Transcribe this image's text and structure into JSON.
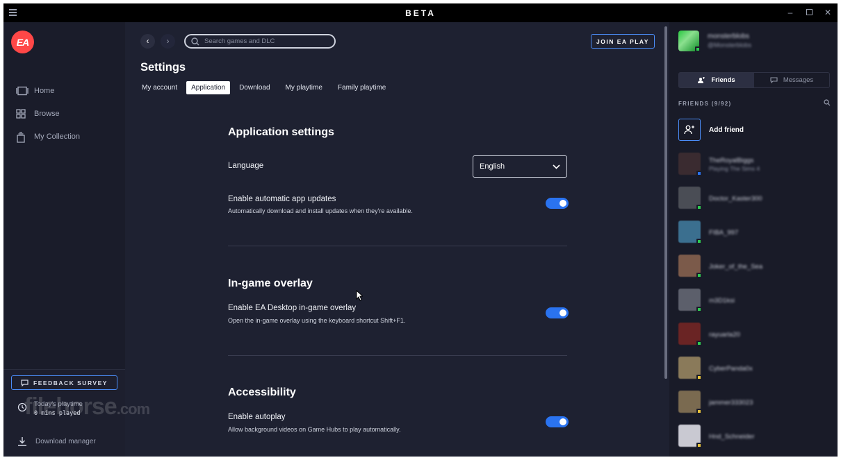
{
  "titlebar": {
    "title": "BETA"
  },
  "leftnav": {
    "items": [
      {
        "label": "Home",
        "icon": "home-icon"
      },
      {
        "label": "Browse",
        "icon": "grid-icon"
      },
      {
        "label": "My Collection",
        "icon": "collection-icon"
      }
    ],
    "feedback_label": "FEEDBACK SURVEY",
    "playtime_label": "Today's playtime",
    "playtime_value": "0 mins played",
    "download_manager": "Download manager"
  },
  "watermark": {
    "brand": "filehorse",
    "suffix": ".com"
  },
  "topbar": {
    "search_placeholder": "Search games and DLC",
    "join_label": "JOIN EA PLAY"
  },
  "settings": {
    "title": "Settings",
    "tabs": [
      "My account",
      "Application",
      "Download",
      "My playtime",
      "Family playtime"
    ],
    "active_tab": "Application",
    "sections": {
      "application": {
        "title": "Application settings",
        "language_label": "Language",
        "language_value": "English",
        "auto_update_label": "Enable automatic app updates",
        "auto_update_desc": "Automatically download and install updates when they're available.",
        "auto_update_on": true
      },
      "overlay": {
        "title": "In-game overlay",
        "label": "Enable EA Desktop in-game overlay",
        "desc": "Open the in-game overlay using the keyboard shortcut Shift+F1.",
        "on": true
      },
      "accessibility": {
        "title": "Accessibility",
        "label": "Enable autoplay",
        "desc": "Allow background videos on Game Hubs to play automatically.",
        "on": true
      }
    }
  },
  "social": {
    "me": {
      "name": "monsterblobs",
      "handle": "@Monsterblobs"
    },
    "tabs": {
      "friends": "Friends",
      "messages": "Messages"
    },
    "friends_header": "FRIENDS (9/92)",
    "add_friend": "Add friend",
    "friends": [
      {
        "name": "TheRoyalBiggs",
        "status": "Playing The Sims 4",
        "color": "#3a2b30",
        "dot": "#2a73f0"
      },
      {
        "name": "Doctor_Kaster300",
        "status": "",
        "color": "#4a4d55",
        "dot": "#2ecc51"
      },
      {
        "name": "FIBA_997",
        "status": "",
        "color": "#3b6f8f",
        "dot": "#2ecc51"
      },
      {
        "name": "Joker_of_the_Sea",
        "status": "",
        "color": "#7b5a4a",
        "dot": "#2ecc51"
      },
      {
        "name": "m3D1ksi",
        "status": "",
        "color": "#5c5f6b",
        "dot": "#2ecc51"
      },
      {
        "name": "rayuarla20",
        "status": "",
        "color": "#6a2424",
        "dot": "#2ecc51"
      },
      {
        "name": "CyberPanda0x",
        "status": "",
        "color": "#8a7a5a",
        "dot": "#e8c33a"
      },
      {
        "name": "jammer333023",
        "status": "",
        "color": "#7a6a50",
        "dot": "#e8c33a"
      },
      {
        "name": "Hnd_Schneider",
        "status": "",
        "color": "#c9c9d2",
        "dot": "#e8c33a"
      }
    ]
  }
}
